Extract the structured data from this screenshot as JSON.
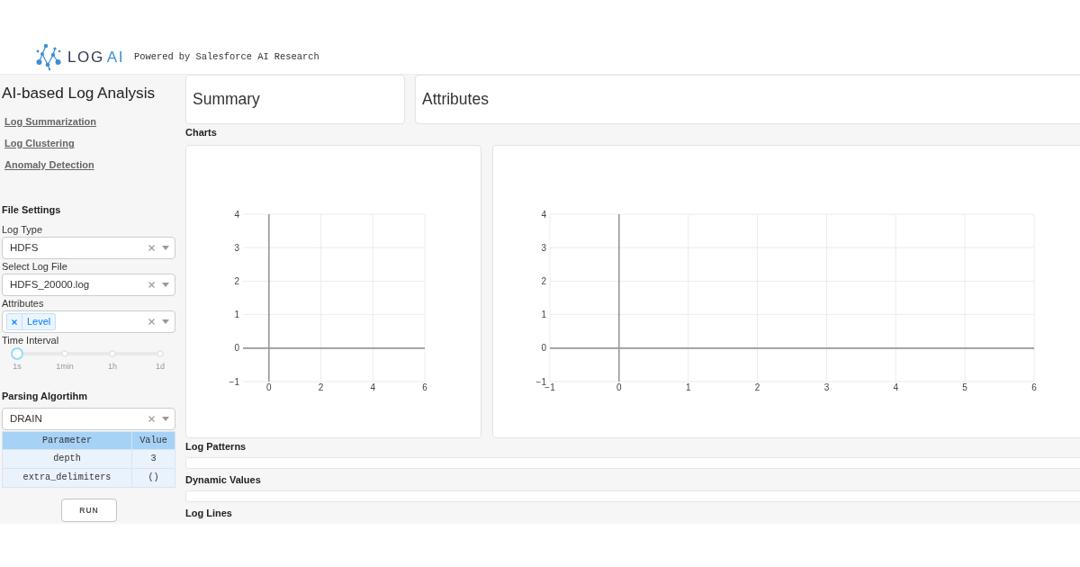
{
  "header": {
    "logo_parts": [
      "LOG",
      "AI"
    ],
    "tagline": "Powered by Salesforce AI Research"
  },
  "sidebar": {
    "title": "AI-based Log Analysis",
    "nav_links": [
      "Log Summarization",
      "Log Clustering",
      "Anomaly Detection"
    ],
    "file_settings": {
      "heading": "File Settings",
      "fields": [
        {
          "kind": "select",
          "label": "Log Type",
          "value": "HDFS"
        },
        {
          "kind": "select",
          "label": "Select Log File",
          "value": "HDFS_20000.log"
        },
        {
          "kind": "multiselect",
          "label": "Attributes",
          "tags": [
            "Level"
          ]
        },
        {
          "kind": "slider",
          "label": "Time Interval",
          "marks": [
            "1s",
            "1min",
            "1h",
            "1d"
          ],
          "level": 0
        }
      ]
    },
    "parsing": {
      "heading": "Parsing Algortihm",
      "algorithm": "DRAIN",
      "table": {
        "columns": [
          "Parameter",
          "Value"
        ],
        "rows": [
          [
            "depth",
            "3"
          ],
          [
            "extra_delimiters",
            "()"
          ]
        ]
      }
    },
    "run_button": "RUN"
  },
  "main": {
    "summary_title": "Summary",
    "attributes_title": "Attributes",
    "charts_heading": "Charts",
    "charts": [
      {
        "chart_data": {
          "type": "line",
          "grid": true,
          "xlim": [
            -1,
            6
          ],
          "ylim": [
            -1,
            4
          ],
          "xticks": [
            0,
            2,
            4,
            6
          ],
          "yticks": [
            {
              "value": -1,
              "label": "−1"
            },
            0,
            1,
            2,
            3,
            4
          ]
        }
      },
      {
        "chart_data": {
          "type": "line",
          "grid": true,
          "xlim": [
            -1,
            6
          ],
          "ylim": [
            -1,
            4
          ],
          "xticks": [
            {
              "value": -1,
              "label": "−1"
            },
            0,
            1,
            2,
            3,
            4,
            5,
            6
          ],
          "yticks": [
            {
              "value": -1,
              "label": "−1"
            },
            0,
            1,
            2,
            3,
            4
          ]
        }
      }
    ],
    "sections": [
      {
        "title": "Log Patterns"
      },
      {
        "title": "Dynamic Values"
      },
      {
        "title": "Log Lines"
      }
    ]
  }
}
